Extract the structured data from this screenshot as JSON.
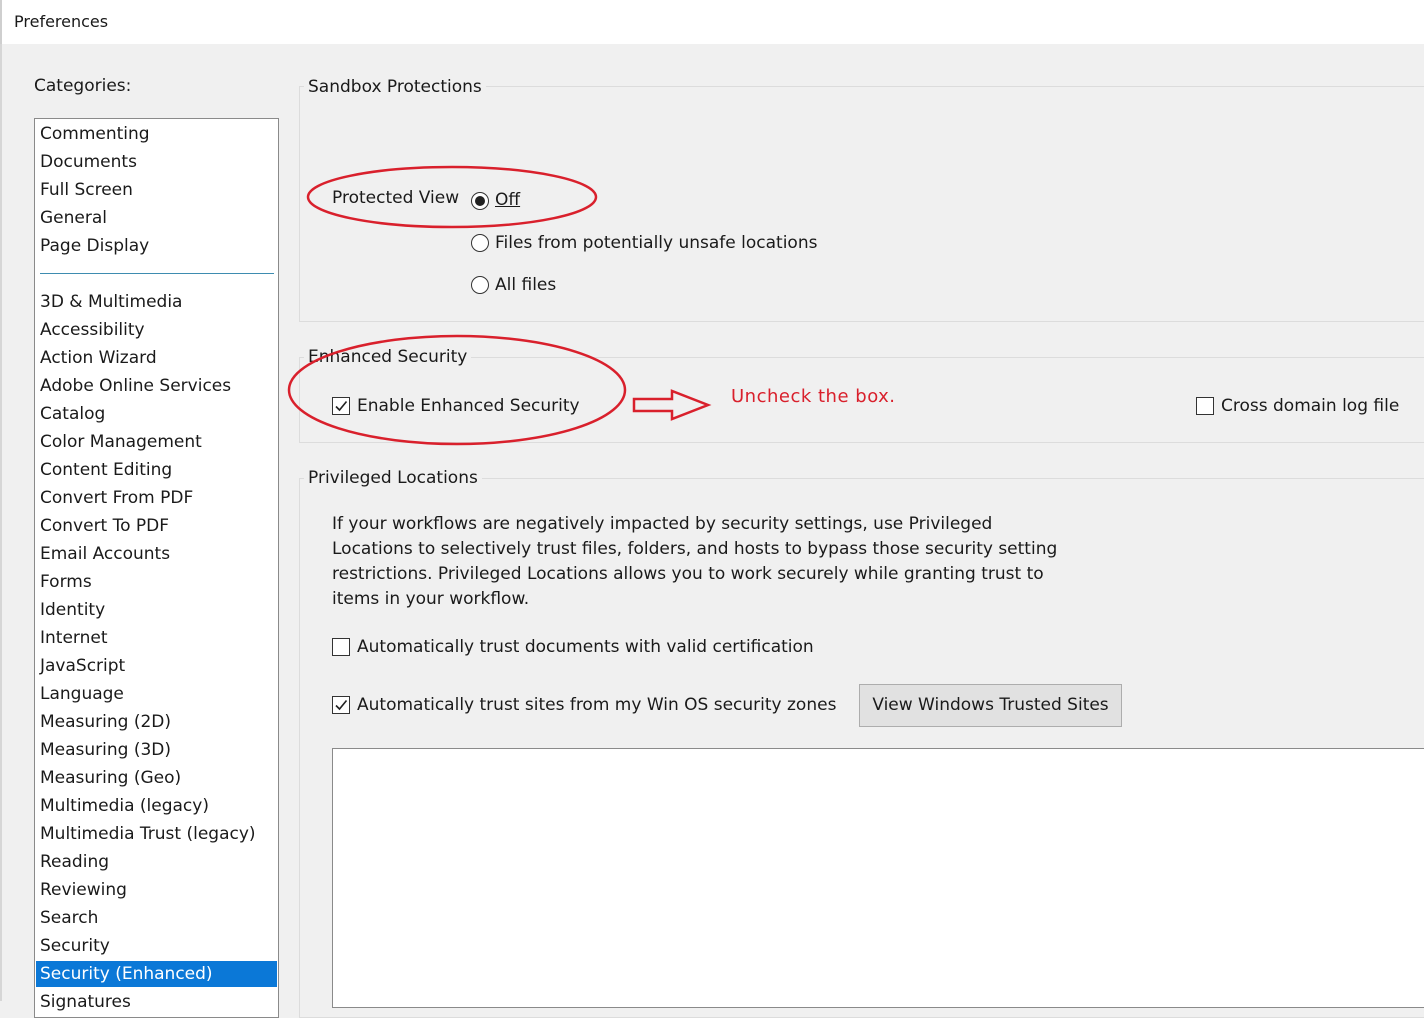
{
  "window": {
    "title": "Preferences"
  },
  "categories": {
    "label": "Categories:",
    "top_items": [
      "Commenting",
      "Documents",
      "Full Screen",
      "General",
      "Page Display"
    ],
    "items": [
      "3D & Multimedia",
      "Accessibility",
      "Action Wizard",
      "Adobe Online Services",
      "Catalog",
      "Color Management",
      "Content Editing",
      "Convert From PDF",
      "Convert To PDF",
      "Email Accounts",
      "Forms",
      "Identity",
      "Internet",
      "JavaScript",
      "Language",
      "Measuring (2D)",
      "Measuring (3D)",
      "Measuring (Geo)",
      "Multimedia (legacy)",
      "Multimedia Trust (legacy)",
      "Reading",
      "Reviewing",
      "Search",
      "Security",
      "Security (Enhanced)",
      "Signatures"
    ],
    "selected": "Security (Enhanced)"
  },
  "sandbox": {
    "title": "Sandbox Protections",
    "protected_view_label": "Protected View",
    "options": [
      "Off",
      "Files from potentially unsafe locations",
      "All files"
    ],
    "selected": "Off"
  },
  "enhanced": {
    "title": "Enhanced Security",
    "enable_label": "Enable Enhanced Security",
    "enable_checked": true,
    "cross_domain_label": "Cross domain log file",
    "cross_domain_checked": false
  },
  "annotation": {
    "text": "Uncheck the box.",
    "color": "#d9202c"
  },
  "privileged": {
    "title": "Privileged Locations",
    "description": "If your workflows are negatively impacted by security settings, use Privileged Locations to selectively trust files, folders, and hosts to bypass those security setting restrictions. Privileged Locations allows you to work securely while granting trust to items in your workflow.",
    "trust_cert_label": "Automatically trust documents with valid certification",
    "trust_cert_checked": false,
    "trust_sites_label": "Automatically trust sites from my Win OS security zones",
    "trust_sites_checked": true,
    "view_sites_button": "View Windows Trusted Sites"
  },
  "colors": {
    "selection": "#0b78d7",
    "annotation": "#d9202c"
  }
}
